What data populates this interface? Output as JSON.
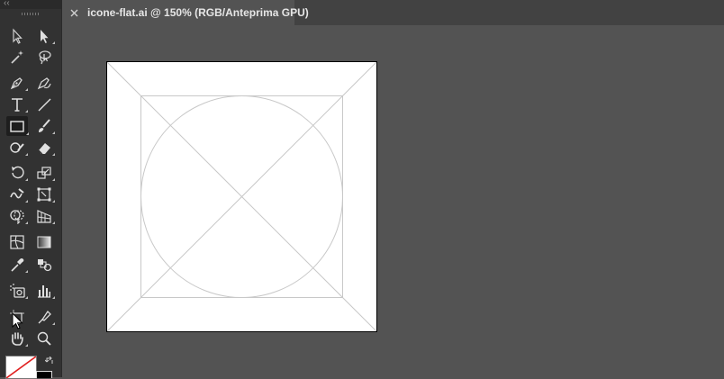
{
  "document_tab": {
    "title": "icone-flat.ai @ 150% (RGB/Anteprima GPU)",
    "close_glyph": "×"
  },
  "toolbar": {
    "collapse_glyph": "‹‹",
    "tools": [
      {
        "name": "selection-tool",
        "icon": "arrow-outline-icon"
      },
      {
        "name": "direct-selection-tool",
        "icon": "arrow-solid-icon"
      },
      {
        "name": "magic-wand-tool",
        "icon": "magic-wand-icon"
      },
      {
        "name": "lasso-tool",
        "icon": "lasso-icon"
      },
      {
        "name": "pen-tool",
        "icon": "pen-icon"
      },
      {
        "name": "curvature-tool",
        "icon": "curvature-pen-icon"
      },
      {
        "name": "type-tool",
        "icon": "type-icon",
        "glyph": "T"
      },
      {
        "name": "line-segment-tool",
        "icon": "line-icon"
      },
      {
        "name": "rectangle-tool",
        "icon": "rectangle-icon",
        "active": true
      },
      {
        "name": "paintbrush-tool",
        "icon": "paintbrush-icon"
      },
      {
        "name": "shaper-tool",
        "icon": "shaper-icon"
      },
      {
        "name": "eraser-tool",
        "icon": "eraser-icon"
      },
      {
        "name": "rotate-tool",
        "icon": "rotate-icon"
      },
      {
        "name": "scale-tool",
        "icon": "scale-icon"
      },
      {
        "name": "warp-tool",
        "icon": "warp-icon"
      },
      {
        "name": "free-transform-tool",
        "icon": "free-transform-icon"
      },
      {
        "name": "shape-builder-tool",
        "icon": "shape-builder-icon"
      },
      {
        "name": "perspective-grid-tool",
        "icon": "perspective-grid-icon"
      },
      {
        "name": "mesh-tool",
        "icon": "mesh-icon"
      },
      {
        "name": "gradient-tool",
        "icon": "gradient-icon"
      },
      {
        "name": "eyedropper-tool",
        "icon": "eyedropper-icon"
      },
      {
        "name": "blend-tool",
        "icon": "blend-icon"
      },
      {
        "name": "symbol-sprayer-tool",
        "icon": "symbol-sprayer-icon"
      },
      {
        "name": "column-graph-tool",
        "icon": "column-graph-icon"
      },
      {
        "name": "artboard-tool",
        "icon": "artboard-icon"
      },
      {
        "name": "slice-tool",
        "icon": "slice-icon"
      },
      {
        "name": "hand-tool",
        "icon": "hand-icon"
      },
      {
        "name": "zoom-tool",
        "icon": "zoom-icon"
      }
    ]
  },
  "fill_stroke": {
    "fill": "none",
    "stroke": "#000000",
    "swap_icon": "swap-icon"
  },
  "colors": {
    "app_background": "#535353",
    "toolbar_background": "#323232",
    "tabbar_background": "#424242",
    "guide_color": "#c8c8c8"
  }
}
